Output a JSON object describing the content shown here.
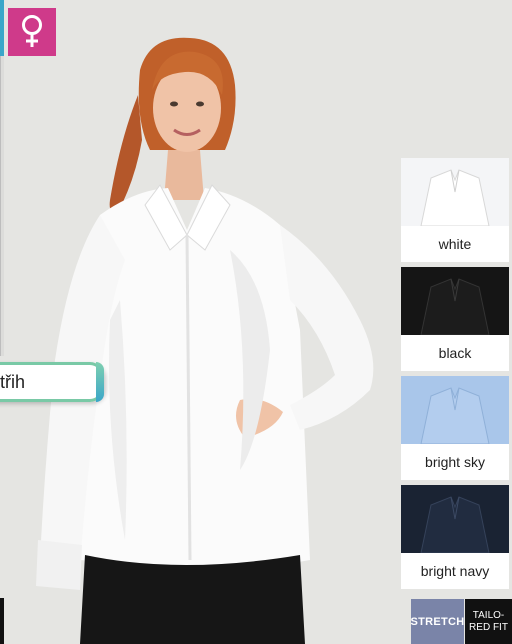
{
  "gender_icon": "female-symbol-icon",
  "colors": {
    "accent_pink": "#cf3a8a",
    "accent_teal": "#3aa6c9",
    "accent_green": "#79c9a6",
    "stretch_badge": "#7a84a8",
    "fit_badge": "#111111"
  },
  "cut_label": "třih",
  "swatches": [
    {
      "label": "white",
      "color": "#f4f5f7"
    },
    {
      "label": "black",
      "color": "#141414"
    },
    {
      "label": "bright sky",
      "color": "#a9c6ea"
    },
    {
      "label": "bright navy",
      "color": "#1a2333"
    }
  ],
  "badges": {
    "stretch": "STRETCH",
    "fit_line1": "TAILO-",
    "fit_line2": "RED FIT"
  }
}
